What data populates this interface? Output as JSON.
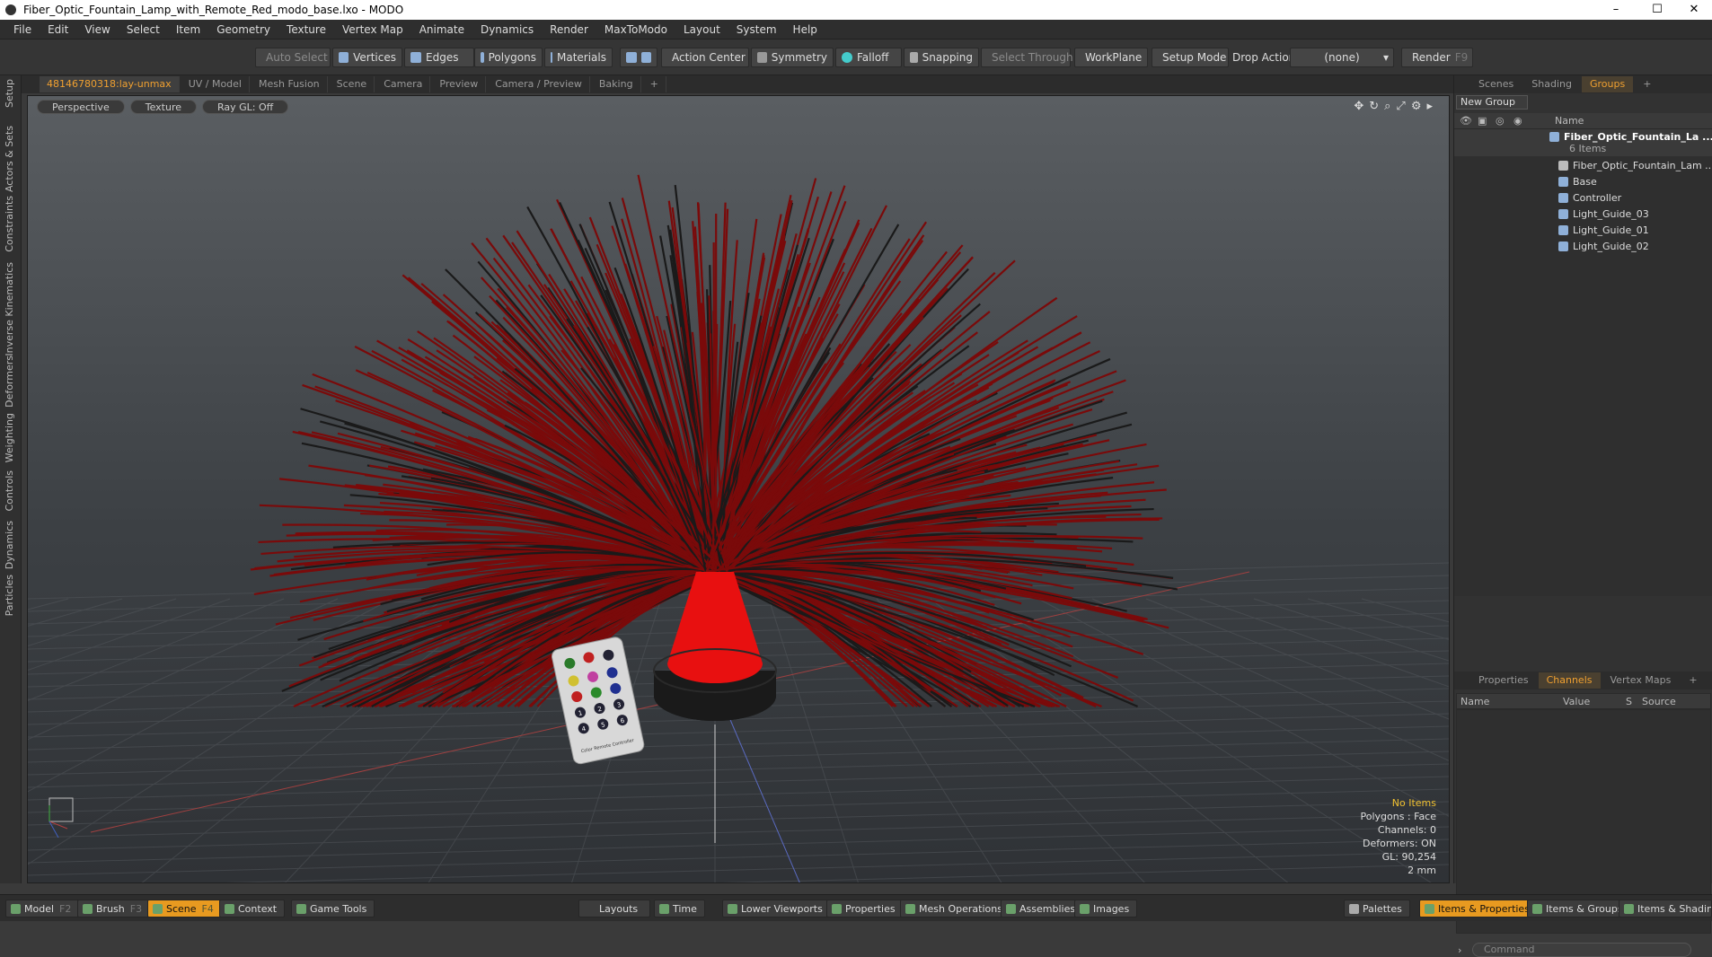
{
  "window": {
    "title": "Fiber_Optic_Fountain_Lamp_with_Remote_Red_modo_base.lxo - MODO",
    "minimize": "–",
    "maximize": "☐",
    "close": "✕"
  },
  "menu": [
    "File",
    "Edit",
    "View",
    "Select",
    "Item",
    "Geometry",
    "Texture",
    "Vertex Map",
    "Animate",
    "Dynamics",
    "Render",
    "MaxToModo",
    "Layout",
    "System",
    "Help"
  ],
  "toolbar": {
    "auto_select": "Auto Select",
    "vertices": "Vertices",
    "edges": "Edges",
    "polygons": "Polygons",
    "materials": "Materials",
    "action_center": "Action Center",
    "symmetry": "Symmetry",
    "falloff": "Falloff",
    "snapping": "Snapping",
    "select_through": "Select Through",
    "workplane": "WorkPlane",
    "setup_mode": "Setup Mode",
    "drop_action": "Drop Action",
    "drop_value": "(none)",
    "render": "Render",
    "render_key": "F9"
  },
  "left_tabs": [
    "Setup",
    "Actors & Sets",
    "Constraints",
    "Inverse Kinematics",
    "Deformers",
    "Weighting",
    "Controls",
    "Dynamics",
    "Particles"
  ],
  "viewport_tabs": [
    "48146780318:lay-unmax",
    "UV / Model",
    "Mesh Fusion",
    "Scene",
    "Camera",
    "Preview",
    "Camera / Preview",
    "Baking",
    "+"
  ],
  "viewport_options": {
    "view": "Perspective",
    "shading": "Texture",
    "raygl": "Ray GL: Off"
  },
  "viewport_info": {
    "selection": "No Items",
    "polygons": "Polygons : Face",
    "channels": "Channels: 0",
    "deformers": "Deformers: ON",
    "gl": "GL: 90,254",
    "unit": "2 mm"
  },
  "scene": {
    "base_color": "#1c1c1c",
    "glow_color": "#e81010",
    "fiber_color": "#7a0a0a",
    "fiber_dark": "#1a1a1a",
    "remote_title": "Color Remote Controller",
    "remote_keys": [
      "1",
      "2",
      "3",
      "4",
      "5",
      "6"
    ]
  },
  "groups_panel": {
    "tabs": [
      "Scenes",
      "Shading",
      "Groups",
      "+"
    ],
    "new_group": "New Group",
    "name_header": "Name",
    "root": {
      "label": "Fiber_Optic_Fountain_La ...",
      "count": "6 Items"
    },
    "items": [
      "Fiber_Optic_Fountain_Lam ...",
      "Base",
      "Controller",
      "Light_Guide_03",
      "Light_Guide_01",
      "Light_Guide_02"
    ]
  },
  "channels_panel": {
    "tabs": [
      "Properties",
      "Channels",
      "Vertex Maps",
      "+"
    ],
    "headers": {
      "name": "Name",
      "value": "Value",
      "s": "S",
      "source": "Source"
    },
    "command_placeholder": "Command"
  },
  "bottom_bar": [
    {
      "label": "Model",
      "key": "F2"
    },
    {
      "label": "Brush",
      "key": "F3"
    },
    {
      "label": "Scene",
      "key": "F4"
    },
    {
      "label": "Context",
      "key": ""
    },
    {
      "label": "Game Tools",
      "key": ""
    },
    {
      "label": "Layouts",
      "key": ""
    },
    {
      "label": "Time",
      "key": ""
    },
    {
      "label": "Lower Viewports",
      "key": ""
    },
    {
      "label": "Properties",
      "key": ""
    },
    {
      "label": "Mesh Operations",
      "key": ""
    },
    {
      "label": "Assemblies",
      "key": ""
    },
    {
      "label": "Images",
      "key": ""
    },
    {
      "label": "Palettes",
      "key": ""
    },
    {
      "label": "Items & Properties",
      "key": ""
    },
    {
      "label": "Items & Groups",
      "key": ""
    },
    {
      "label": "Items & Shading",
      "key": ""
    }
  ]
}
